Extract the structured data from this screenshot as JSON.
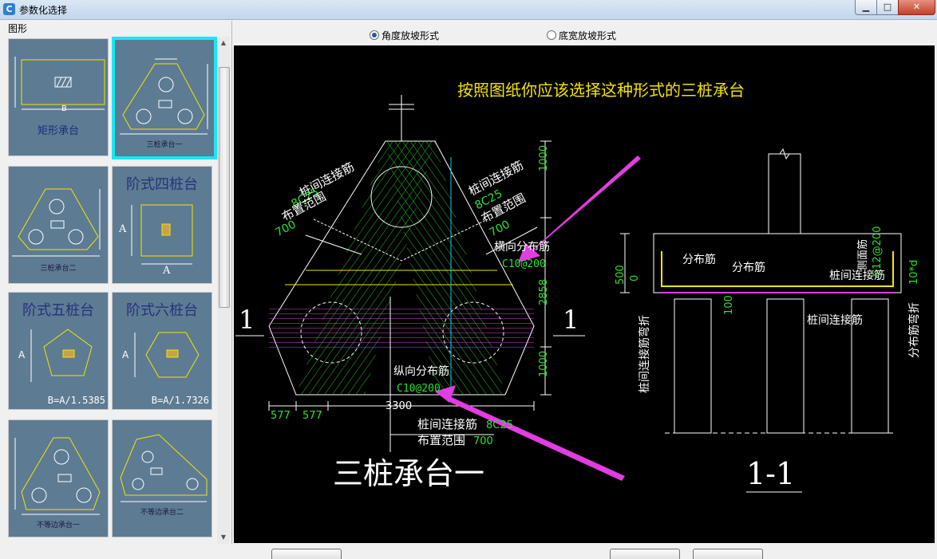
{
  "window": {
    "title": "参数化选择",
    "icon_letter": "C"
  },
  "left_panel": {
    "group_label": "图形",
    "thumbnails": [
      {
        "label": "矩形承台",
        "dim": "B"
      },
      {
        "label": "三桩承台一"
      },
      {
        "label": "三桩承台二"
      },
      {
        "label": "阶式四桩台",
        "dim_a": "A",
        "dim_a2": "A"
      },
      {
        "label": "阶式五桩台",
        "dim_a": "A",
        "formula": "B=A/1.5385"
      },
      {
        "label": "阶式六桩台",
        "dim_a": "A",
        "formula": "B=A/1.7326"
      },
      {
        "label": "不等边承台一"
      },
      {
        "label": "不等边承台二"
      }
    ]
  },
  "radio_options": [
    {
      "label": "角度放坡形式",
      "selected": true
    },
    {
      "label": "底宽放坡形式",
      "selected": false
    }
  ],
  "drawing": {
    "hint": "按照图纸你应该选择这种形式的三桩承台",
    "title_main": "三桩承台一",
    "title_section": "1-1",
    "section_mark_left": "1",
    "section_mark_right": "1",
    "plan_labels": {
      "left_a": "桩间连接筋",
      "left_b": "8C25",
      "left_c": "布置范围",
      "left_d": "700",
      "right_a": "桩间连接筋",
      "right_b": "8C25",
      "right_c": "布置范围",
      "right_d": "700",
      "transverse": "横向分布筋",
      "transverse_spec": "C10@200",
      "longitudinal": "纵向分布筋",
      "longitudinal_spec": "C10@200",
      "bottom_a": "桩间连接筋",
      "bottom_b": "8C25",
      "bottom_c": "布置范围",
      "bottom_d": "700"
    },
    "dimensions": {
      "right_1": "1000",
      "right_2": "2858",
      "right_3": "1000",
      "bottom_1": "577",
      "bottom_2": "577",
      "bottom_total": "3300"
    },
    "section_labels": {
      "dist_a": "分布筋",
      "dist_b": "分布筋",
      "conn": "桩间连接筋",
      "conn_bottom": "桩间连接筋",
      "side": "侧面筋",
      "side_spec": "C12@200",
      "h500": "500",
      "h0": "0",
      "h100": "100",
      "bend_left": "桩间连接筋弯折",
      "bend_right": "分布筋弯折",
      "tend": "10*d"
    }
  },
  "colors": {
    "canvas_bg": "#000000",
    "highlight_border": "#17e7f7",
    "hint_yellow": "#f4e400",
    "cad_green": "#2fe02f",
    "cad_magenta": "#e23de2",
    "arrow_magenta": "#e23de2"
  }
}
